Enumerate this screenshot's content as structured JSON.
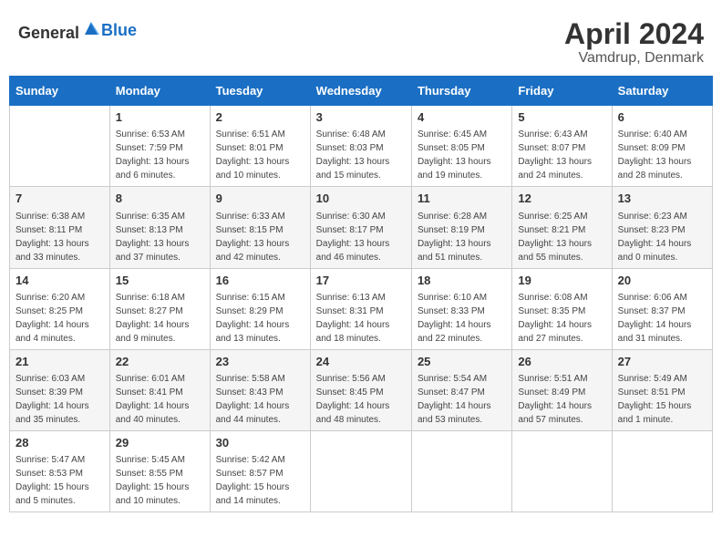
{
  "header": {
    "logo_general": "General",
    "logo_blue": "Blue",
    "month_title": "April 2024",
    "location": "Vamdrup, Denmark"
  },
  "days_of_week": [
    "Sunday",
    "Monday",
    "Tuesday",
    "Wednesday",
    "Thursday",
    "Friday",
    "Saturday"
  ],
  "weeks": [
    [
      {
        "day": "",
        "info": ""
      },
      {
        "day": "1",
        "info": "Sunrise: 6:53 AM\nSunset: 7:59 PM\nDaylight: 13 hours\nand 6 minutes."
      },
      {
        "day": "2",
        "info": "Sunrise: 6:51 AM\nSunset: 8:01 PM\nDaylight: 13 hours\nand 10 minutes."
      },
      {
        "day": "3",
        "info": "Sunrise: 6:48 AM\nSunset: 8:03 PM\nDaylight: 13 hours\nand 15 minutes."
      },
      {
        "day": "4",
        "info": "Sunrise: 6:45 AM\nSunset: 8:05 PM\nDaylight: 13 hours\nand 19 minutes."
      },
      {
        "day": "5",
        "info": "Sunrise: 6:43 AM\nSunset: 8:07 PM\nDaylight: 13 hours\nand 24 minutes."
      },
      {
        "day": "6",
        "info": "Sunrise: 6:40 AM\nSunset: 8:09 PM\nDaylight: 13 hours\nand 28 minutes."
      }
    ],
    [
      {
        "day": "7",
        "info": "Sunrise: 6:38 AM\nSunset: 8:11 PM\nDaylight: 13 hours\nand 33 minutes."
      },
      {
        "day": "8",
        "info": "Sunrise: 6:35 AM\nSunset: 8:13 PM\nDaylight: 13 hours\nand 37 minutes."
      },
      {
        "day": "9",
        "info": "Sunrise: 6:33 AM\nSunset: 8:15 PM\nDaylight: 13 hours\nand 42 minutes."
      },
      {
        "day": "10",
        "info": "Sunrise: 6:30 AM\nSunset: 8:17 PM\nDaylight: 13 hours\nand 46 minutes."
      },
      {
        "day": "11",
        "info": "Sunrise: 6:28 AM\nSunset: 8:19 PM\nDaylight: 13 hours\nand 51 minutes."
      },
      {
        "day": "12",
        "info": "Sunrise: 6:25 AM\nSunset: 8:21 PM\nDaylight: 13 hours\nand 55 minutes."
      },
      {
        "day": "13",
        "info": "Sunrise: 6:23 AM\nSunset: 8:23 PM\nDaylight: 14 hours\nand 0 minutes."
      }
    ],
    [
      {
        "day": "14",
        "info": "Sunrise: 6:20 AM\nSunset: 8:25 PM\nDaylight: 14 hours\nand 4 minutes."
      },
      {
        "day": "15",
        "info": "Sunrise: 6:18 AM\nSunset: 8:27 PM\nDaylight: 14 hours\nand 9 minutes."
      },
      {
        "day": "16",
        "info": "Sunrise: 6:15 AM\nSunset: 8:29 PM\nDaylight: 14 hours\nand 13 minutes."
      },
      {
        "day": "17",
        "info": "Sunrise: 6:13 AM\nSunset: 8:31 PM\nDaylight: 14 hours\nand 18 minutes."
      },
      {
        "day": "18",
        "info": "Sunrise: 6:10 AM\nSunset: 8:33 PM\nDaylight: 14 hours\nand 22 minutes."
      },
      {
        "day": "19",
        "info": "Sunrise: 6:08 AM\nSunset: 8:35 PM\nDaylight: 14 hours\nand 27 minutes."
      },
      {
        "day": "20",
        "info": "Sunrise: 6:06 AM\nSunset: 8:37 PM\nDaylight: 14 hours\nand 31 minutes."
      }
    ],
    [
      {
        "day": "21",
        "info": "Sunrise: 6:03 AM\nSunset: 8:39 PM\nDaylight: 14 hours\nand 35 minutes."
      },
      {
        "day": "22",
        "info": "Sunrise: 6:01 AM\nSunset: 8:41 PM\nDaylight: 14 hours\nand 40 minutes."
      },
      {
        "day": "23",
        "info": "Sunrise: 5:58 AM\nSunset: 8:43 PM\nDaylight: 14 hours\nand 44 minutes."
      },
      {
        "day": "24",
        "info": "Sunrise: 5:56 AM\nSunset: 8:45 PM\nDaylight: 14 hours\nand 48 minutes."
      },
      {
        "day": "25",
        "info": "Sunrise: 5:54 AM\nSunset: 8:47 PM\nDaylight: 14 hours\nand 53 minutes."
      },
      {
        "day": "26",
        "info": "Sunrise: 5:51 AM\nSunset: 8:49 PM\nDaylight: 14 hours\nand 57 minutes."
      },
      {
        "day": "27",
        "info": "Sunrise: 5:49 AM\nSunset: 8:51 PM\nDaylight: 15 hours\nand 1 minute."
      }
    ],
    [
      {
        "day": "28",
        "info": "Sunrise: 5:47 AM\nSunset: 8:53 PM\nDaylight: 15 hours\nand 5 minutes."
      },
      {
        "day": "29",
        "info": "Sunrise: 5:45 AM\nSunset: 8:55 PM\nDaylight: 15 hours\nand 10 minutes."
      },
      {
        "day": "30",
        "info": "Sunrise: 5:42 AM\nSunset: 8:57 PM\nDaylight: 15 hours\nand 14 minutes."
      },
      {
        "day": "",
        "info": ""
      },
      {
        "day": "",
        "info": ""
      },
      {
        "day": "",
        "info": ""
      },
      {
        "day": "",
        "info": ""
      }
    ]
  ]
}
